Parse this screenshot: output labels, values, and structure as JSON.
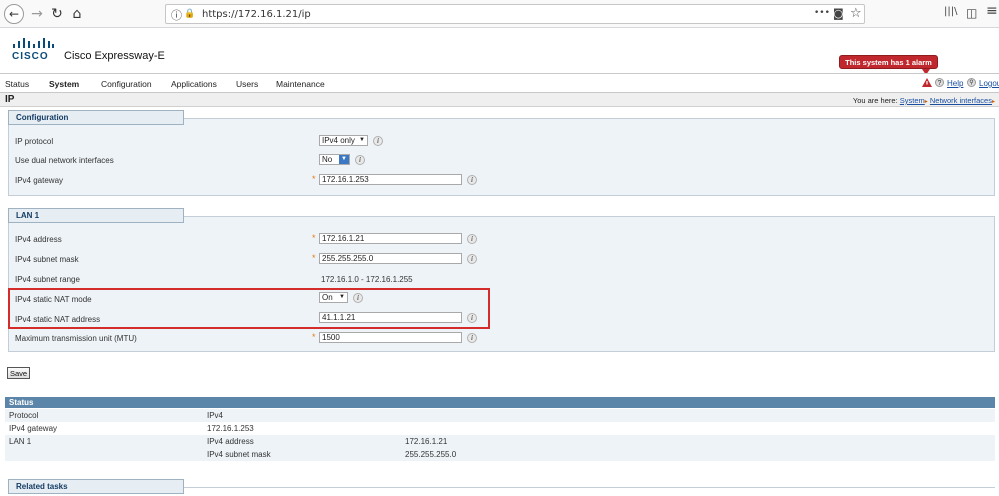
{
  "browser": {
    "back_glyph": "←",
    "forward_glyph": "→",
    "reload_glyph": "↻",
    "home_glyph": "⌂",
    "info_glyph": "ⓘ",
    "lock_glyph": "🔒",
    "url": "https://172.16.1.21/ip",
    "menu_dots": "•••",
    "pocket_glyph": "◙",
    "bookmark_glyph": "☆",
    "library_glyph": "|||\\",
    "sidebar_glyph": "◫",
    "hamburger_glyph": "≡"
  },
  "header": {
    "logo_text": "CISCO",
    "product_title": "Cisco Expressway-E",
    "alarm_text": "This system has 1 alarm"
  },
  "menu": {
    "items": [
      "Status",
      "System",
      "Configuration",
      "Applications",
      "Users",
      "Maintenance"
    ],
    "active": "System",
    "help": "Help",
    "logout": "Logou"
  },
  "page": {
    "title": "IP",
    "breadcrumb_prefix": "You are here:",
    "breadcrumb": [
      "System",
      "Network interfaces"
    ],
    "breadcrumb_sep": "▸"
  },
  "configuration": {
    "title": "Configuration",
    "ip_protocol_label": "IP protocol",
    "ip_protocol_value": "IPv4 only",
    "dual_nic_label": "Use dual network interfaces",
    "dual_nic_value": "No",
    "gateway_label": "IPv4 gateway",
    "gateway_value": "172.16.1.253"
  },
  "lan1": {
    "title": "LAN 1",
    "address_label": "IPv4 address",
    "address_value": "172.16.1.21",
    "mask_label": "IPv4 subnet mask",
    "mask_value": "255.255.255.0",
    "range_label": "IPv4 subnet range",
    "range_value": "172.16.1.0 - 172.16.1.255",
    "nat_mode_label": "IPv4 static NAT mode",
    "nat_mode_value": "On",
    "nat_address_label": "IPv4 static NAT address",
    "nat_address_value": "41.1.1.21",
    "mtu_label": "Maximum transmission unit (MTU)",
    "mtu_value": "1500"
  },
  "form": {
    "save_label": "Save",
    "required_star": "*",
    "info_glyph": "i",
    "arrow_glyph": "▼"
  },
  "status": {
    "title": "Status",
    "rows": [
      [
        "Protocol",
        "IPv4",
        ""
      ],
      [
        "IPv4 gateway",
        "172.16.1.253",
        ""
      ],
      [
        "LAN 1",
        "IPv4 address",
        "172.16.1.21"
      ],
      [
        "",
        "IPv4 subnet mask",
        "255.255.255.0"
      ]
    ]
  },
  "related": {
    "title": "Related tasks"
  }
}
